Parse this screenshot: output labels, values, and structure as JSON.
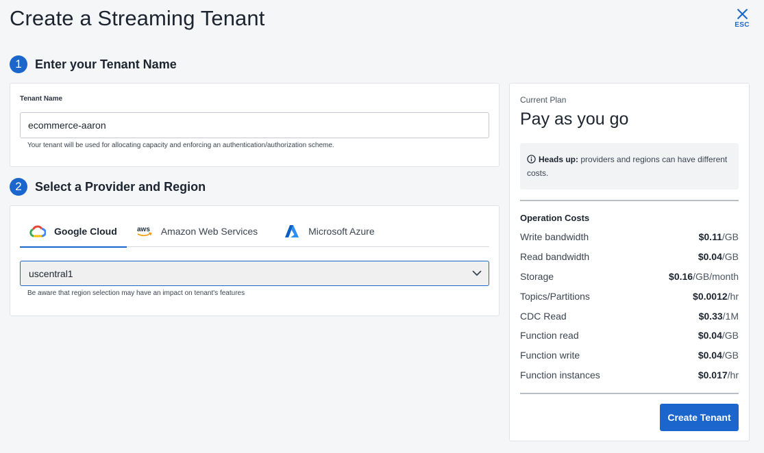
{
  "page": {
    "title": "Create a Streaming Tenant",
    "close_label": "ESC"
  },
  "steps": [
    {
      "number": "1",
      "title": "Enter your Tenant Name"
    },
    {
      "number": "2",
      "title": "Select a Provider and Region"
    }
  ],
  "tenant": {
    "label": "Tenant Name",
    "value": "ecommerce-aaron",
    "helper": "Your tenant will be used for allocating capacity and enforcing an authentication/authorization scheme."
  },
  "provider": {
    "tabs": [
      {
        "label": "Google Cloud",
        "icon": "google-cloud-icon",
        "active": true
      },
      {
        "label": "Amazon Web Services",
        "icon": "aws-icon",
        "active": false
      },
      {
        "label": "Microsoft Azure",
        "icon": "azure-icon",
        "active": false
      }
    ],
    "region": "uscentral1",
    "helper": "Be aware that region selection may have an impact on tenant's features"
  },
  "plan": {
    "label": "Current Plan",
    "name": "Pay as you go",
    "notice_bold": "Heads up:",
    "notice_text": " providers and regions can have different costs.",
    "costs_title": "Operation Costs",
    "costs": [
      {
        "name": "Write bandwidth",
        "amount": "$0.11",
        "unit": "/GB"
      },
      {
        "name": "Read bandwidth",
        "amount": "$0.04",
        "unit": "/GB"
      },
      {
        "name": "Storage",
        "amount": "$0.16",
        "unit": "/GB/month"
      },
      {
        "name": "Topics/Partitions",
        "amount": "$0.0012",
        "unit": "/hr"
      },
      {
        "name": "CDC Read",
        "amount": "$0.33",
        "unit": "/1M"
      },
      {
        "name": "Function read",
        "amount": "$0.04",
        "unit": "/GB"
      },
      {
        "name": "Function write",
        "amount": "$0.04",
        "unit": "/GB"
      },
      {
        "name": "Function instances",
        "amount": "$0.017",
        "unit": "/hr"
      }
    ],
    "create_label": "Create Tenant"
  },
  "colors": {
    "primary": "#1a66cc",
    "background": "#f5f6f8"
  }
}
